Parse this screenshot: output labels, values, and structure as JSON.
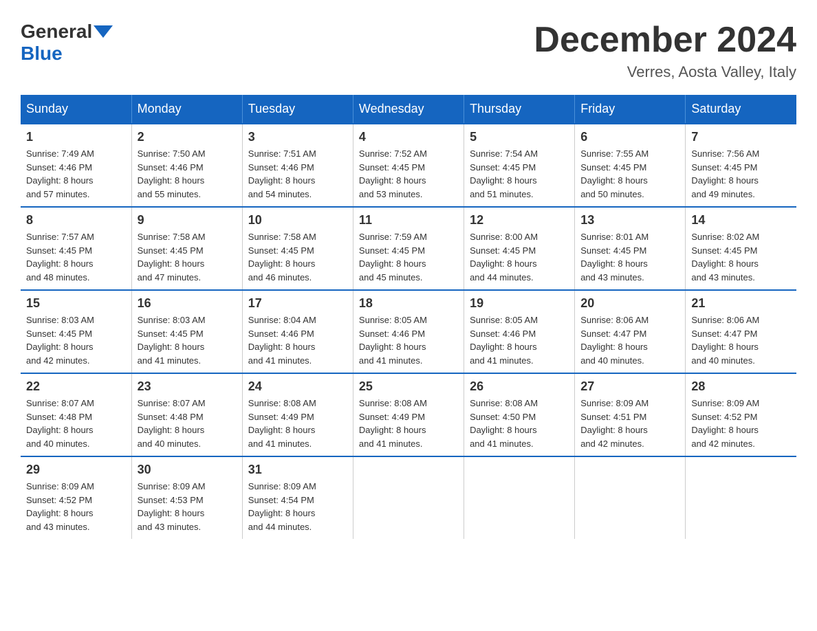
{
  "header": {
    "logo_general": "General",
    "logo_blue": "Blue",
    "month_title": "December 2024",
    "location": "Verres, Aosta Valley, Italy"
  },
  "days_of_week": [
    "Sunday",
    "Monday",
    "Tuesday",
    "Wednesday",
    "Thursday",
    "Friday",
    "Saturday"
  ],
  "weeks": [
    [
      {
        "day": "1",
        "sunrise": "7:49 AM",
        "sunset": "4:46 PM",
        "daylight": "8 hours and 57 minutes."
      },
      {
        "day": "2",
        "sunrise": "7:50 AM",
        "sunset": "4:46 PM",
        "daylight": "8 hours and 55 minutes."
      },
      {
        "day": "3",
        "sunrise": "7:51 AM",
        "sunset": "4:46 PM",
        "daylight": "8 hours and 54 minutes."
      },
      {
        "day": "4",
        "sunrise": "7:52 AM",
        "sunset": "4:45 PM",
        "daylight": "8 hours and 53 minutes."
      },
      {
        "day": "5",
        "sunrise": "7:54 AM",
        "sunset": "4:45 PM",
        "daylight": "8 hours and 51 minutes."
      },
      {
        "day": "6",
        "sunrise": "7:55 AM",
        "sunset": "4:45 PM",
        "daylight": "8 hours and 50 minutes."
      },
      {
        "day": "7",
        "sunrise": "7:56 AM",
        "sunset": "4:45 PM",
        "daylight": "8 hours and 49 minutes."
      }
    ],
    [
      {
        "day": "8",
        "sunrise": "7:57 AM",
        "sunset": "4:45 PM",
        "daylight": "8 hours and 48 minutes."
      },
      {
        "day": "9",
        "sunrise": "7:58 AM",
        "sunset": "4:45 PM",
        "daylight": "8 hours and 47 minutes."
      },
      {
        "day": "10",
        "sunrise": "7:58 AM",
        "sunset": "4:45 PM",
        "daylight": "8 hours and 46 minutes."
      },
      {
        "day": "11",
        "sunrise": "7:59 AM",
        "sunset": "4:45 PM",
        "daylight": "8 hours and 45 minutes."
      },
      {
        "day": "12",
        "sunrise": "8:00 AM",
        "sunset": "4:45 PM",
        "daylight": "8 hours and 44 minutes."
      },
      {
        "day": "13",
        "sunrise": "8:01 AM",
        "sunset": "4:45 PM",
        "daylight": "8 hours and 43 minutes."
      },
      {
        "day": "14",
        "sunrise": "8:02 AM",
        "sunset": "4:45 PM",
        "daylight": "8 hours and 43 minutes."
      }
    ],
    [
      {
        "day": "15",
        "sunrise": "8:03 AM",
        "sunset": "4:45 PM",
        "daylight": "8 hours and 42 minutes."
      },
      {
        "day": "16",
        "sunrise": "8:03 AM",
        "sunset": "4:45 PM",
        "daylight": "8 hours and 41 minutes."
      },
      {
        "day": "17",
        "sunrise": "8:04 AM",
        "sunset": "4:46 PM",
        "daylight": "8 hours and 41 minutes."
      },
      {
        "day": "18",
        "sunrise": "8:05 AM",
        "sunset": "4:46 PM",
        "daylight": "8 hours and 41 minutes."
      },
      {
        "day": "19",
        "sunrise": "8:05 AM",
        "sunset": "4:46 PM",
        "daylight": "8 hours and 41 minutes."
      },
      {
        "day": "20",
        "sunrise": "8:06 AM",
        "sunset": "4:47 PM",
        "daylight": "8 hours and 40 minutes."
      },
      {
        "day": "21",
        "sunrise": "8:06 AM",
        "sunset": "4:47 PM",
        "daylight": "8 hours and 40 minutes."
      }
    ],
    [
      {
        "day": "22",
        "sunrise": "8:07 AM",
        "sunset": "4:48 PM",
        "daylight": "8 hours and 40 minutes."
      },
      {
        "day": "23",
        "sunrise": "8:07 AM",
        "sunset": "4:48 PM",
        "daylight": "8 hours and 40 minutes."
      },
      {
        "day": "24",
        "sunrise": "8:08 AM",
        "sunset": "4:49 PM",
        "daylight": "8 hours and 41 minutes."
      },
      {
        "day": "25",
        "sunrise": "8:08 AM",
        "sunset": "4:49 PM",
        "daylight": "8 hours and 41 minutes."
      },
      {
        "day": "26",
        "sunrise": "8:08 AM",
        "sunset": "4:50 PM",
        "daylight": "8 hours and 41 minutes."
      },
      {
        "day": "27",
        "sunrise": "8:09 AM",
        "sunset": "4:51 PM",
        "daylight": "8 hours and 42 minutes."
      },
      {
        "day": "28",
        "sunrise": "8:09 AM",
        "sunset": "4:52 PM",
        "daylight": "8 hours and 42 minutes."
      }
    ],
    [
      {
        "day": "29",
        "sunrise": "8:09 AM",
        "sunset": "4:52 PM",
        "daylight": "8 hours and 43 minutes."
      },
      {
        "day": "30",
        "sunrise": "8:09 AM",
        "sunset": "4:53 PM",
        "daylight": "8 hours and 43 minutes."
      },
      {
        "day": "31",
        "sunrise": "8:09 AM",
        "sunset": "4:54 PM",
        "daylight": "8 hours and 44 minutes."
      },
      null,
      null,
      null,
      null
    ]
  ],
  "labels": {
    "sunrise": "Sunrise:",
    "sunset": "Sunset:",
    "daylight": "Daylight:"
  }
}
